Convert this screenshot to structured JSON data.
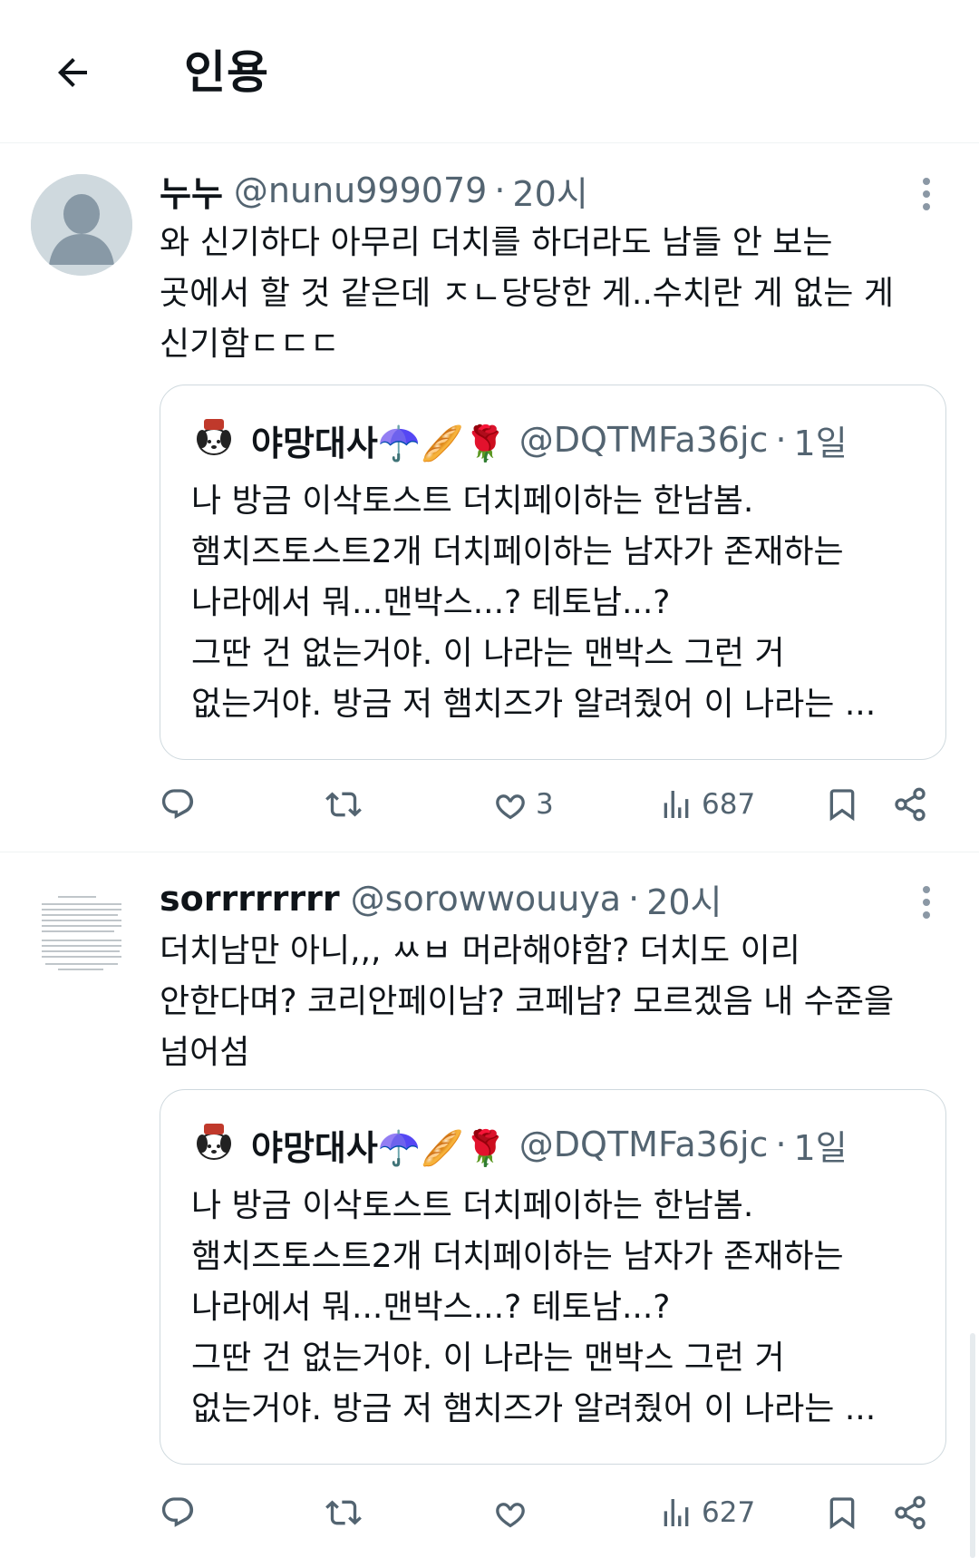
{
  "header": {
    "title": "인용"
  },
  "tweets": [
    {
      "display_name": "누누",
      "handle": "@nunu999079",
      "separator": "·",
      "time": "20시",
      "text": "와 신기하다 아무리 더치를 하더라도 남들 안 보는\n곳에서 할 것 같은데 ㅈㄴ당당한 게..수치란 게 없는 게\n신기함ㄷㄷㄷ",
      "quote": {
        "display_name": "야망대사☂️🥖🌹",
        "handle": "@DQTMFa36jc",
        "separator": "·",
        "time": "1일",
        "text": "나 방금 이삭토스트 더치페이하는 한남봄.\n햄치즈토스트2개 더치페이하는 남자가 존재하는\n나라에서 뭐...맨박스...? 테토남...?\n그딴 건 없는거야. 이 나라는 맨박스 그런 거\n없는거야. 방금 저 햄치즈가 알려줬어 이 나라는 ..."
      },
      "stats": {
        "likes": "3",
        "views": "687"
      }
    },
    {
      "display_name": "sorrrrrrrr",
      "handle": "@sorowwouuya",
      "separator": "·",
      "time": "20시",
      "text": "더치남만 아니,,, ㅆㅂ 머라해야함? 더치도 이리\n안한다며? 코리안페이남? 코페남? 모르겠음 내 수준을\n넘어섬",
      "quote": {
        "display_name": "야망대사☂️🥖🌹",
        "handle": "@DQTMFa36jc",
        "separator": "·",
        "time": "1일",
        "text": "나 방금 이삭토스트 더치페이하는 한남봄.\n햄치즈토스트2개 더치페이하는 남자가 존재하는\n나라에서 뭐...맨박스...? 테토남...?\n그딴 건 없는거야. 이 나라는 맨박스 그런 거\n없는거야. 방금 저 햄치즈가 알려줬어 이 나라는 ..."
      },
      "stats": {
        "likes": "",
        "views": "627"
      }
    }
  ],
  "colors": {
    "text": "#0f1419",
    "muted": "#536471",
    "border": "#cfd9de",
    "divider": "#eff3f4"
  }
}
